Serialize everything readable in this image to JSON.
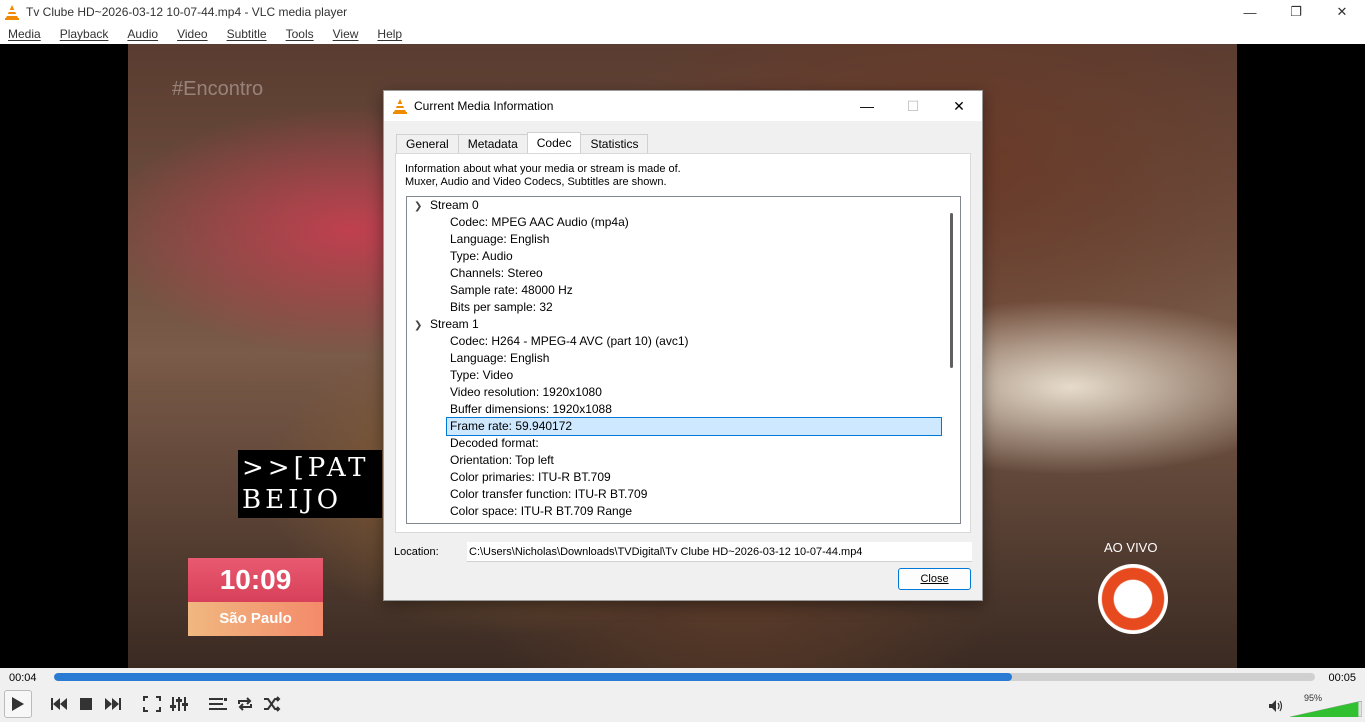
{
  "window": {
    "title": "Tv Clube HD~2026-03-12 10-07-44.mp4 - VLC media player",
    "minimize": "—",
    "maximize": "❐",
    "close": "✕"
  },
  "menu": [
    "Media",
    "Playback",
    "Audio",
    "Video",
    "Subtitle",
    "Tools",
    "View",
    "Help"
  ],
  "video": {
    "watermark": "#Encontro",
    "caption_line1": ">>[PAT",
    "caption_line2": "BEIJO",
    "clock_time": "10:09",
    "clock_city": "São Paulo",
    "live_label": "AO VIVO"
  },
  "dialog": {
    "title": "Current Media Information",
    "minimize": "—",
    "maximize": "☐",
    "close": "✕",
    "tabs": [
      "General",
      "Metadata",
      "Codec",
      "Statistics"
    ],
    "active_tab": "Codec",
    "desc_line1": "Information about what your media or stream is made of.",
    "desc_line2": "Muxer, Audio and Video Codecs, Subtitles are shown.",
    "streams": [
      {
        "name": "Stream 0",
        "items": [
          "Codec: MPEG AAC Audio (mp4a)",
          "Language: English",
          "Type: Audio",
          "Channels: Stereo",
          "Sample rate: 48000 Hz",
          "Bits per sample: 32"
        ]
      },
      {
        "name": "Stream 1",
        "items": [
          "Codec: H264 - MPEG-4 AVC (part 10) (avc1)",
          "Language: English",
          "Type: Video",
          "Video resolution: 1920x1080",
          "Buffer dimensions: 1920x1088",
          "Frame rate: 59.940172",
          "Decoded format:",
          "Orientation: Top left",
          "Color primaries: ITU-R BT.709",
          "Color transfer function: ITU-R BT.709",
          "Color space: ITU-R BT.709 Range"
        ]
      }
    ],
    "selected_item": "Frame rate: 59.940172",
    "location_label": "Location:",
    "location_value": "C:\\Users\\Nicholas\\Downloads\\TVDigital\\Tv Clube HD~2026-03-12 10-07-44.mp4",
    "close_button": "Close"
  },
  "player": {
    "elapsed": "00:04",
    "total": "00:05",
    "progress_fraction": 0.76,
    "volume": "95%",
    "volume_fraction": 0.95,
    "accent_color": "#2a7bd4",
    "volume_color": "#30c030"
  }
}
